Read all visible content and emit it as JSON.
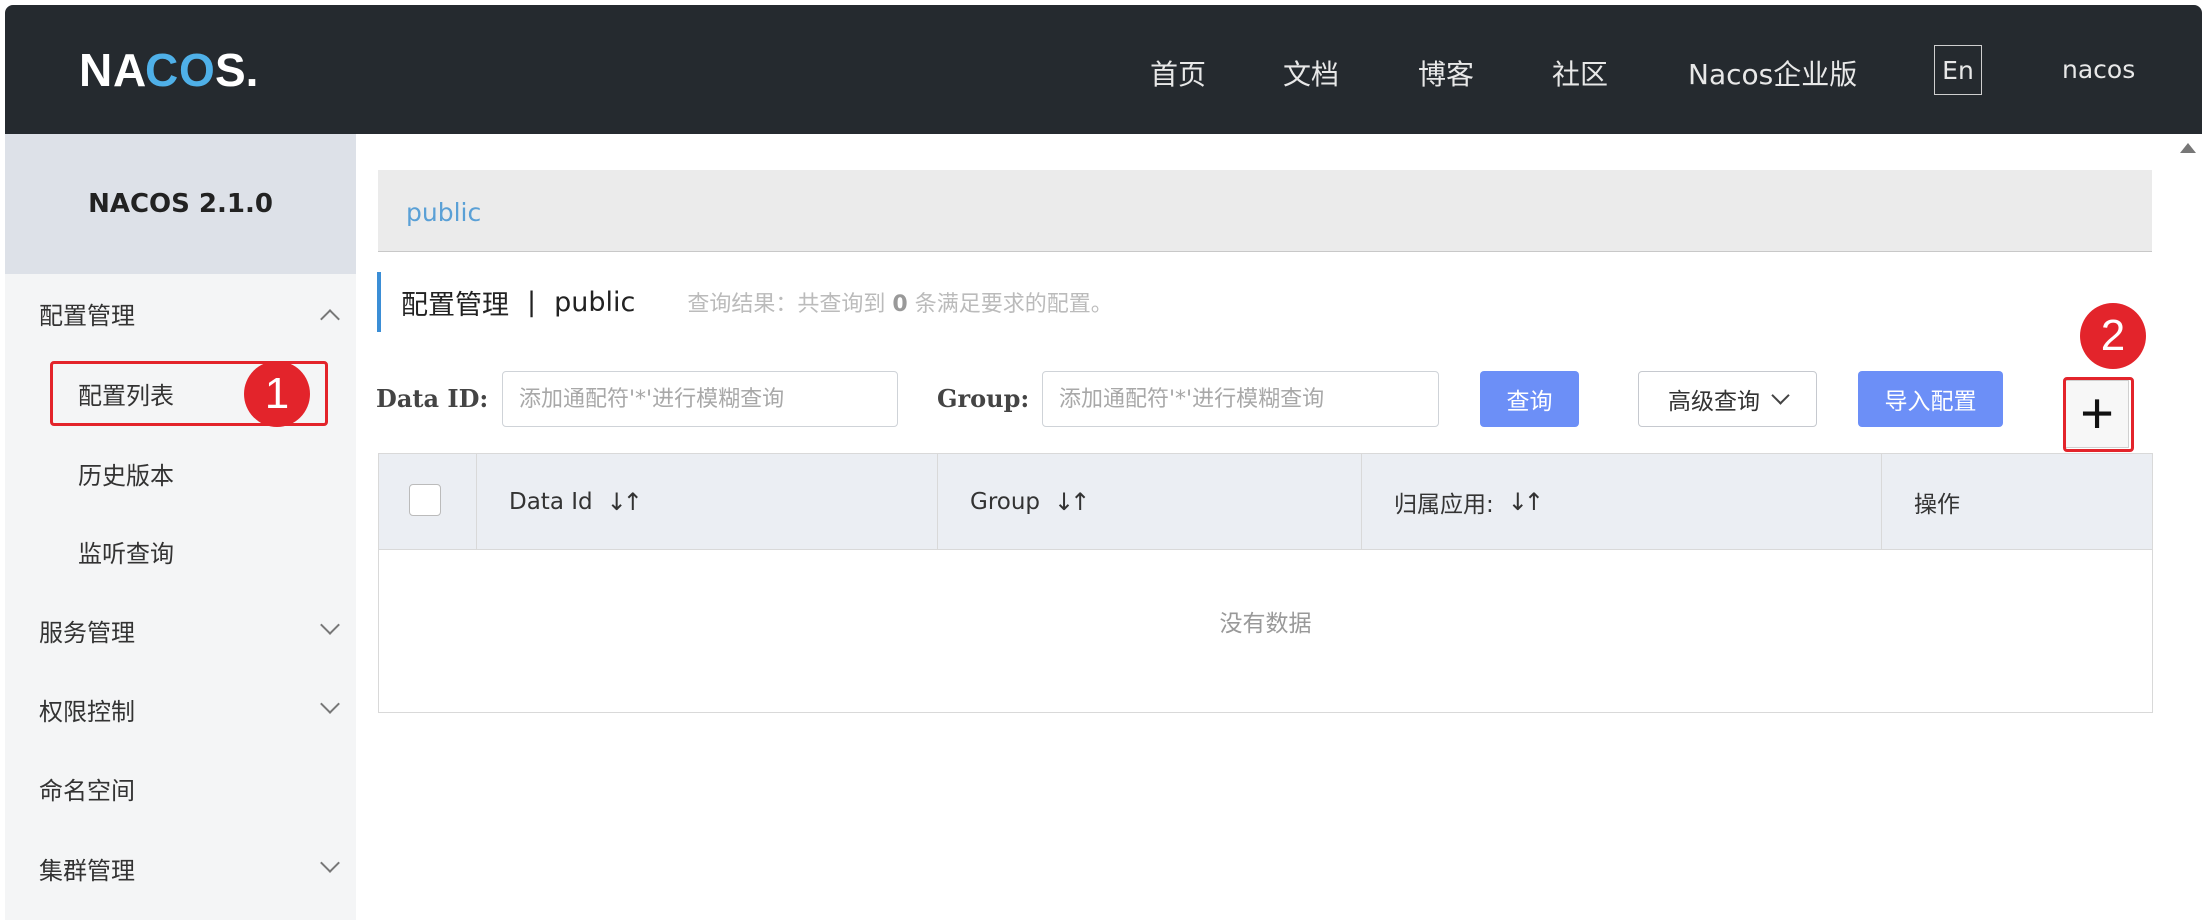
{
  "header": {
    "logo_text": "NACOS.",
    "nav": [
      "首页",
      "文档",
      "博客",
      "社区",
      "Nacos企业版"
    ],
    "lang_button": "En",
    "user": "nacos"
  },
  "sidebar": {
    "version": "NACOS 2.1.0",
    "items": [
      {
        "label": "配置管理",
        "expanded": true
      },
      {
        "label": "配置列表"
      },
      {
        "label": "历史版本"
      },
      {
        "label": "监听查询"
      },
      {
        "label": "服务管理"
      },
      {
        "label": "权限控制"
      },
      {
        "label": "命名空间"
      },
      {
        "label": "集群管理"
      }
    ]
  },
  "namespace_bar": {
    "selected": "public"
  },
  "page": {
    "title": "配置管理",
    "separator": "|",
    "namespace": "public",
    "query_prefix": "查询结果：共查询到",
    "query_count": "0",
    "query_suffix": "条满足要求的配置。"
  },
  "filters": {
    "data_id_label": "Data ID:",
    "data_id_placeholder": "添加通配符'*'进行模糊查询",
    "group_label": "Group:",
    "group_placeholder": "添加通配符'*'进行模糊查询",
    "query_button": "查询",
    "advanced_button": "高级查询",
    "import_button": "导入配置",
    "add_button": "+"
  },
  "table": {
    "columns": [
      "Data Id",
      "Group",
      "归属应用:",
      "操作"
    ],
    "sort_glyph": "↓↑",
    "empty_text": "没有数据"
  },
  "annotations": [
    "1",
    "2"
  ],
  "colors": {
    "header_bg": "#252a2f",
    "primary": "#6c8ff7",
    "annotation": "#e3242b",
    "accent_link": "#5aa0d6"
  }
}
